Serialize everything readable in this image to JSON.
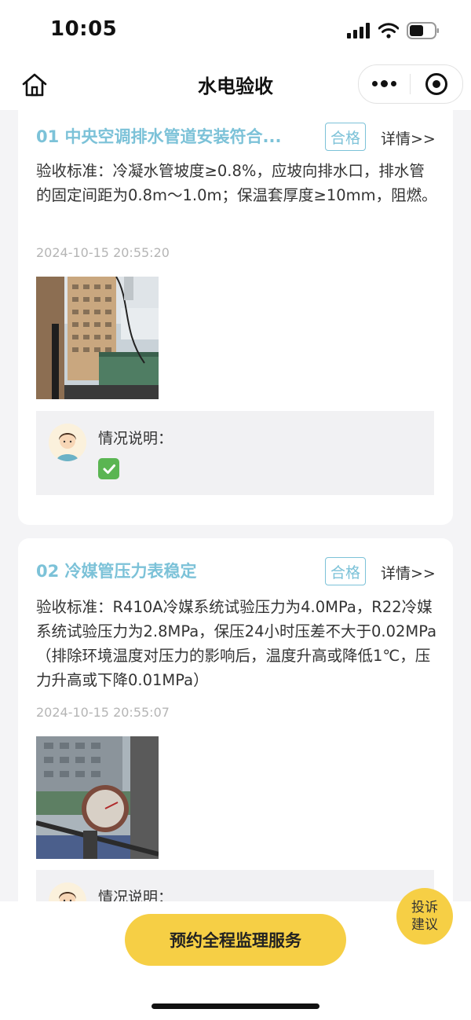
{
  "status_bar": {
    "time": "10:05"
  },
  "nav": {
    "title": "水电验收"
  },
  "items": [
    {
      "title": "01 中央空调排水管道安装符合...",
      "badge": "合格",
      "detail": "详情>>",
      "standard": "验收标准：冷凝水管坡度≥0.8%，应坡向排水口，排水管的固定间距为0.8m～1.0m；保温套厚度≥10mm，阻燃。",
      "timestamp": "2024-10-15 20:55:20",
      "note_label": "情况说明：",
      "note_status": "approved"
    },
    {
      "title": "02 冷媒管压力表稳定",
      "badge": "合格",
      "detail": "详情>>",
      "standard": "验收标准：R410A冷媒系统试验压力为4.0MPa，R22冷媒系统试验压力为2.8MPa，保压24小时压差不大于0.02MPa（排除环境温度对压力的影响后，温度升高或降低1℃，压力升高或下降0.01MPa）",
      "timestamp": "2024-10-15 20:55:07",
      "note_label": "情况说明："
    }
  ],
  "bottom": {
    "book_button": "预约全程监理服务"
  },
  "complaint": {
    "line1": "投诉",
    "line2": "建议"
  },
  "colors": {
    "accent": "#7cc2d8",
    "primary_button": "#f6cf45",
    "background": "#f4f4f6"
  }
}
